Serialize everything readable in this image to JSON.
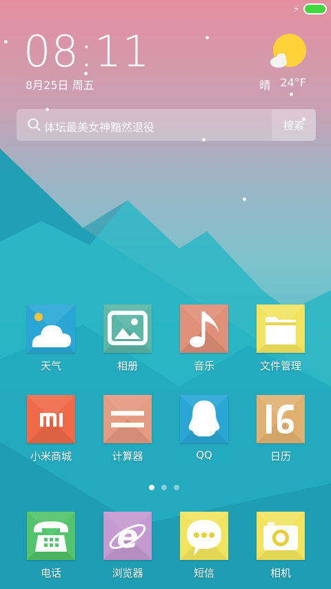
{
  "status_bar": {
    "battery_level": 1.0,
    "charging": true
  },
  "clock": {
    "time": "08:11",
    "date": "8月25日 周五"
  },
  "weather": {
    "condition": "晴",
    "temperature": "24°F",
    "icon": "sun-cloud-icon"
  },
  "search": {
    "query": "体坛最美女神黯然退役",
    "button": "搜索"
  },
  "apps": [
    {
      "label": "天气",
      "icon": "weather-icon",
      "color": "#2aa6d6"
    },
    {
      "label": "相册",
      "icon": "gallery-icon",
      "color": "#5bb7a6"
    },
    {
      "label": "音乐",
      "icon": "music-note-icon",
      "color": "#e08f78"
    },
    {
      "label": "文件管理",
      "icon": "folder-icon",
      "color": "#f2e35c"
    },
    {
      "label": "小米商城",
      "icon": "mi-logo-icon",
      "color": "#f06a49"
    },
    {
      "label": "计算器",
      "icon": "calculator-icon",
      "color": "#e59a82"
    },
    {
      "label": "QQ",
      "icon": "qq-penguin-icon",
      "color": "#2aa6d6"
    },
    {
      "label": "日历",
      "icon": "calendar-icon",
      "color": "#e0b070"
    }
  ],
  "pager": {
    "count": 3,
    "active": 0
  },
  "dock": [
    {
      "label": "电话",
      "icon": "phone-icon",
      "color": "#52c46c"
    },
    {
      "label": "浏览器",
      "icon": "browser-icon",
      "color": "#c59ad0"
    },
    {
      "label": "短信",
      "icon": "message-icon",
      "color": "#f2e35c"
    },
    {
      "label": "相机",
      "icon": "camera-icon",
      "color": "#f2e35c"
    }
  ]
}
